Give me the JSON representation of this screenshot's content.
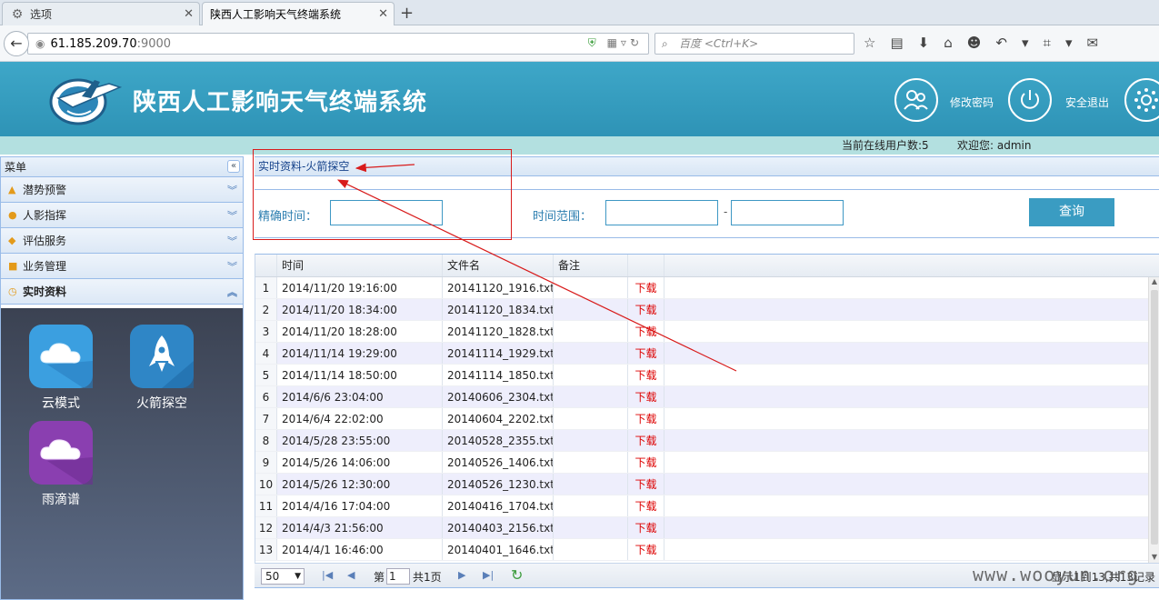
{
  "browser": {
    "tabs": [
      {
        "label": "选项",
        "active": false
      },
      {
        "label": "陕西人工影响天气终端系统",
        "active": true
      }
    ],
    "url_host": "61.185.209.70",
    "url_port": ":9000",
    "search_placeholder": "百度 <Ctrl+K>"
  },
  "header": {
    "title": "陕西人工影响天气终端系统",
    "change_password": "修改密码",
    "logout": "安全退出"
  },
  "infobar": {
    "online_users": "当前在线用户数:5",
    "welcome": "欢迎您:  admin"
  },
  "sidebar": {
    "title": "菜单",
    "items": [
      {
        "label": "潜势预警",
        "icon": "bell-icon"
      },
      {
        "label": "人影指挥",
        "icon": "pin-icon"
      },
      {
        "label": "评估服务",
        "icon": "thumb-icon"
      },
      {
        "label": "业务管理",
        "icon": "book-icon"
      },
      {
        "label": "实时资料",
        "icon": "clock-icon"
      }
    ],
    "apps": [
      {
        "label": "云模式",
        "color": "#3b9fe0"
      },
      {
        "label": "火箭探空",
        "color": "#2f86c6"
      },
      {
        "label": "雨滴谱",
        "color": "#8a3fb0"
      }
    ]
  },
  "main": {
    "breadcrumb": "实时资料-火箭探空",
    "exact_time_label": "精确时间：",
    "range_label": "时间范围：",
    "range_sep": "-",
    "query_button": "查询"
  },
  "grid": {
    "columns": [
      "时间",
      "文件名",
      "备注",
      ""
    ],
    "rows": [
      {
        "n": "1",
        "time": "2014/11/20 19:16:00",
        "file": "20141120_1916.txt",
        "note": "",
        "action": "下载"
      },
      {
        "n": "2",
        "time": "2014/11/20 18:34:00",
        "file": "20141120_1834.txt",
        "note": "",
        "action": "下载"
      },
      {
        "n": "3",
        "time": "2014/11/20 18:28:00",
        "file": "20141120_1828.txt",
        "note": "",
        "action": "下载"
      },
      {
        "n": "4",
        "time": "2014/11/14 19:29:00",
        "file": "20141114_1929.txt",
        "note": "",
        "action": "下载"
      },
      {
        "n": "5",
        "time": "2014/11/14 18:50:00",
        "file": "20141114_1850.txt",
        "note": "",
        "action": "下载"
      },
      {
        "n": "6",
        "time": "2014/6/6 23:04:00",
        "file": "20140606_2304.txt",
        "note": "",
        "action": "下载"
      },
      {
        "n": "7",
        "time": "2014/6/4 22:02:00",
        "file": "20140604_2202.txt",
        "note": "",
        "action": "下载"
      },
      {
        "n": "8",
        "time": "2014/5/28 23:55:00",
        "file": "20140528_2355.txt",
        "note": "",
        "action": "下载"
      },
      {
        "n": "9",
        "time": "2014/5/26 14:06:00",
        "file": "20140526_1406.txt",
        "note": "",
        "action": "下载"
      },
      {
        "n": "10",
        "time": "2014/5/26 12:30:00",
        "file": "20140526_1230.txt",
        "note": "",
        "action": "下载"
      },
      {
        "n": "11",
        "time": "2014/4/16 17:04:00",
        "file": "20140416_1704.txt",
        "note": "",
        "action": "下载"
      },
      {
        "n": "12",
        "time": "2014/4/3 21:56:00",
        "file": "20140403_2156.txt",
        "note": "",
        "action": "下载"
      },
      {
        "n": "13",
        "time": "2014/4/1 16:46:00",
        "file": "20140401_1646.txt",
        "note": "",
        "action": "下载"
      }
    ]
  },
  "pager": {
    "page_size": "50",
    "page_prefix": "第",
    "page_value": "1",
    "page_total": "共1页",
    "info": "显示1到13,共13记录"
  },
  "watermark": "www.wooyun.org"
}
